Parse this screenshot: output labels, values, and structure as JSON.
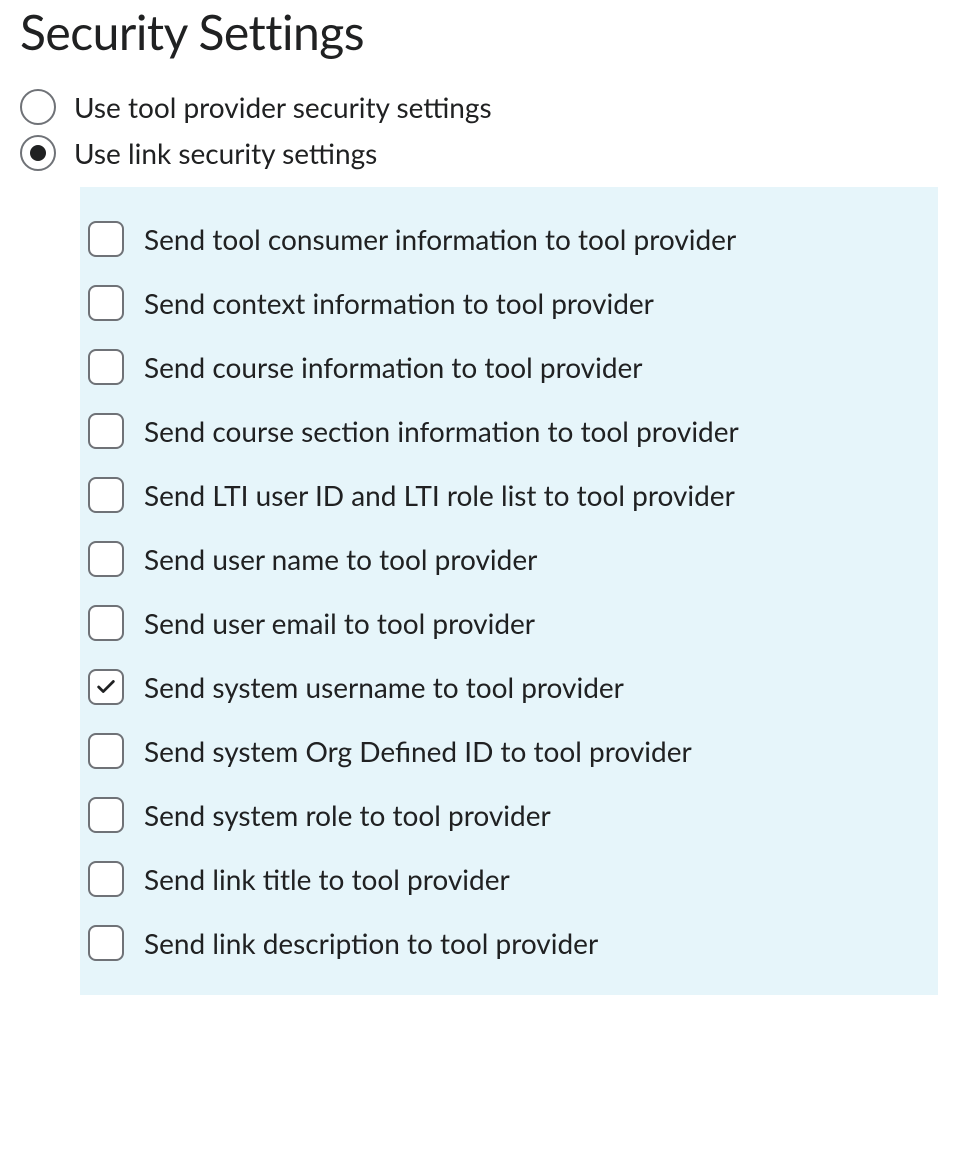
{
  "heading": "Security Settings",
  "radios": [
    {
      "label": "Use tool provider security settings",
      "selected": false
    },
    {
      "label": "Use link security settings",
      "selected": true
    }
  ],
  "checkboxes": [
    {
      "label": "Send tool consumer information to tool provider",
      "checked": false
    },
    {
      "label": "Send context information to tool provider",
      "checked": false
    },
    {
      "label": "Send course information to tool provider",
      "checked": false
    },
    {
      "label": "Send course section information to tool provider",
      "checked": false
    },
    {
      "label": "Send LTI user ID and LTI role list to tool provider",
      "checked": false
    },
    {
      "label": "Send user name to tool provider",
      "checked": false
    },
    {
      "label": "Send user email to tool provider",
      "checked": false
    },
    {
      "label": "Send system username to tool provider",
      "checked": true
    },
    {
      "label": "Send system Org Defined ID to tool provider",
      "checked": false
    },
    {
      "label": "Send system role to tool provider",
      "checked": false
    },
    {
      "label": "Send link title to tool provider",
      "checked": false
    },
    {
      "label": "Send link description to tool provider",
      "checked": false
    }
  ]
}
